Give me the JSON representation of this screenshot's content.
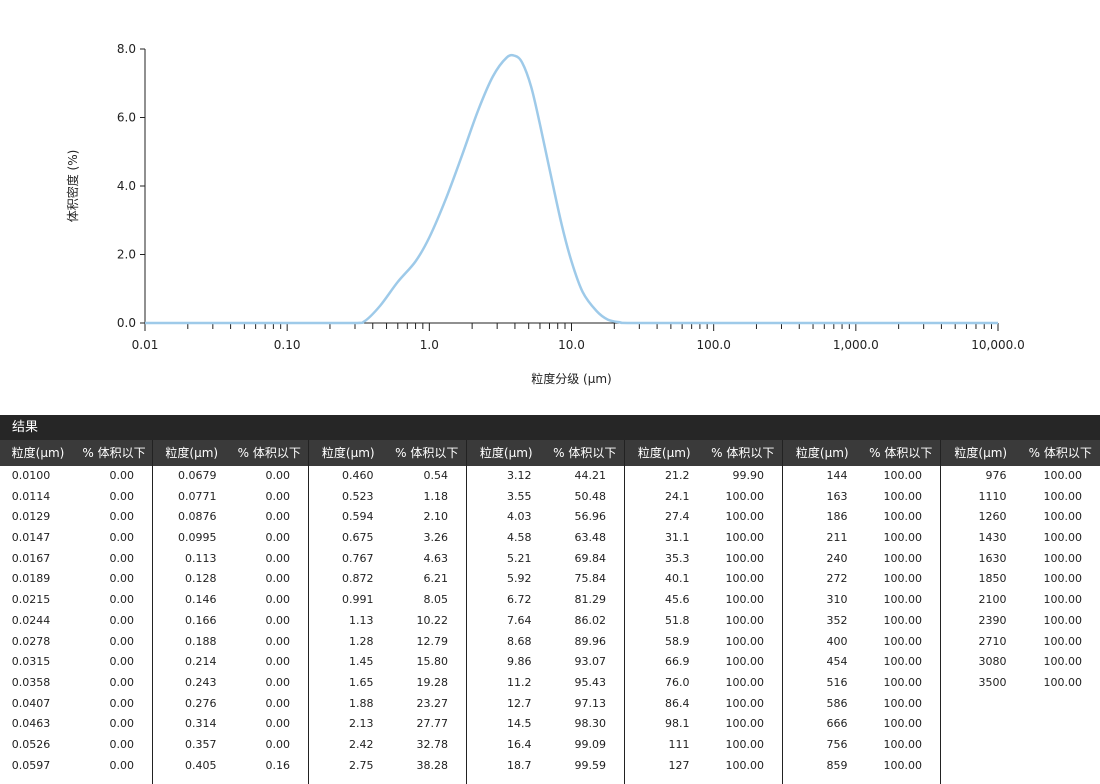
{
  "chart_data": {
    "type": "line",
    "ylabel": "体积密度 (%)",
    "xlabel": "粒度分级 (μm)",
    "x_scale": "log",
    "xlim": [
      0.01,
      10000
    ],
    "ylim": [
      0,
      8
    ],
    "x_ticks": [
      "0.01",
      "0.10",
      "1.0",
      "10.0",
      "100.0",
      "1,000.0",
      "10,000.0"
    ],
    "y_ticks": [
      "0.0",
      "2.0",
      "4.0",
      "6.0",
      "8.0"
    ],
    "line_color": "#9ecae9",
    "series": [
      {
        "x": [
          0.01,
          0.1,
          0.3,
          0.35,
          0.45,
          0.6,
          0.8,
          1.0,
          1.3,
          1.7,
          2.2,
          2.8,
          3.5,
          4.0,
          4.5,
          5.2,
          6.0,
          7.0,
          8.5,
          10.0,
          12.0,
          15.0,
          18.0,
          22.0,
          26.0,
          100,
          1000,
          10000
        ],
        "y": [
          0.0,
          0.0,
          0.0,
          0.05,
          0.5,
          1.2,
          1.8,
          2.5,
          3.6,
          4.9,
          6.2,
          7.2,
          7.75,
          7.8,
          7.6,
          6.9,
          5.8,
          4.5,
          2.9,
          1.8,
          0.9,
          0.35,
          0.1,
          0.02,
          0.0,
          0.0,
          0.0,
          0.0
        ]
      }
    ]
  },
  "results": {
    "title": "结果",
    "col_size_label": "粒度(μm)",
    "col_vol_label": "% 体积以下",
    "groups": [
      {
        "sizes": [
          "0.0100",
          "0.0114",
          "0.0129",
          "0.0147",
          "0.0167",
          "0.0189",
          "0.0215",
          "0.0244",
          "0.0278",
          "0.0315",
          "0.0358",
          "0.0407",
          "0.0463",
          "0.0526",
          "0.0597"
        ],
        "vols": [
          "0.00",
          "0.00",
          "0.00",
          "0.00",
          "0.00",
          "0.00",
          "0.00",
          "0.00",
          "0.00",
          "0.00",
          "0.00",
          "0.00",
          "0.00",
          "0.00",
          "0.00"
        ]
      },
      {
        "sizes": [
          "0.0679",
          "0.0771",
          "0.0876",
          "0.0995",
          "0.113",
          "0.128",
          "0.146",
          "0.166",
          "0.188",
          "0.214",
          "0.243",
          "0.276",
          "0.314",
          "0.357",
          "0.405"
        ],
        "vols": [
          "0.00",
          "0.00",
          "0.00",
          "0.00",
          "0.00",
          "0.00",
          "0.00",
          "0.00",
          "0.00",
          "0.00",
          "0.00",
          "0.00",
          "0.00",
          "0.00",
          "0.16"
        ]
      },
      {
        "sizes": [
          "0.460",
          "0.523",
          "0.594",
          "0.675",
          "0.767",
          "0.872",
          "0.991",
          "1.13",
          "1.28",
          "1.45",
          "1.65",
          "1.88",
          "2.13",
          "2.42",
          "2.75"
        ],
        "vols": [
          "0.54",
          "1.18",
          "2.10",
          "3.26",
          "4.63",
          "6.21",
          "8.05",
          "10.22",
          "12.79",
          "15.80",
          "19.28",
          "23.27",
          "27.77",
          "32.78",
          "38.28"
        ]
      },
      {
        "sizes": [
          "3.12",
          "3.55",
          "4.03",
          "4.58",
          "5.21",
          "5.92",
          "6.72",
          "7.64",
          "8.68",
          "9.86",
          "11.2",
          "12.7",
          "14.5",
          "16.4",
          "18.7"
        ],
        "vols": [
          "44.21",
          "50.48",
          "56.96",
          "63.48",
          "69.84",
          "75.84",
          "81.29",
          "86.02",
          "89.96",
          "93.07",
          "95.43",
          "97.13",
          "98.30",
          "99.09",
          "99.59"
        ]
      },
      {
        "sizes": [
          "21.2",
          "24.1",
          "27.4",
          "31.1",
          "35.3",
          "40.1",
          "45.6",
          "51.8",
          "58.9",
          "66.9",
          "76.0",
          "86.4",
          "98.1",
          "111",
          "127"
        ],
        "vols": [
          "99.90",
          "100.00",
          "100.00",
          "100.00",
          "100.00",
          "100.00",
          "100.00",
          "100.00",
          "100.00",
          "100.00",
          "100.00",
          "100.00",
          "100.00",
          "100.00",
          "100.00"
        ]
      },
      {
        "sizes": [
          "144",
          "163",
          "186",
          "211",
          "240",
          "272",
          "310",
          "352",
          "400",
          "454",
          "516",
          "586",
          "666",
          "756",
          "859"
        ],
        "vols": [
          "100.00",
          "100.00",
          "100.00",
          "100.00",
          "100.00",
          "100.00",
          "100.00",
          "100.00",
          "100.00",
          "100.00",
          "100.00",
          "100.00",
          "100.00",
          "100.00",
          "100.00"
        ]
      },
      {
        "sizes": [
          "976",
          "1110",
          "1260",
          "1430",
          "1630",
          "1850",
          "2100",
          "2390",
          "2710",
          "3080",
          "3500"
        ],
        "vols": [
          "100.00",
          "100.00",
          "100.00",
          "100.00",
          "100.00",
          "100.00",
          "100.00",
          "100.00",
          "100.00",
          "100.00",
          "100.00"
        ]
      }
    ]
  }
}
